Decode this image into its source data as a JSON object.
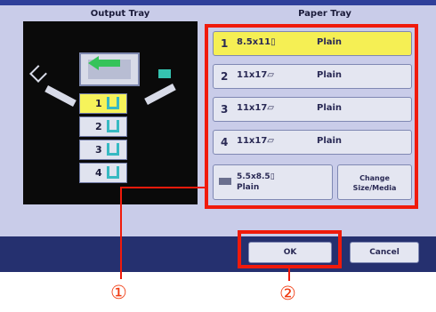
{
  "headers": {
    "output_tray": "Output Tray",
    "paper_tray": "Paper Tray"
  },
  "output_bins": [
    {
      "number": "1",
      "selected": true
    },
    {
      "number": "2",
      "selected": false
    },
    {
      "number": "3",
      "selected": false
    },
    {
      "number": "4",
      "selected": false
    }
  ],
  "paper_trays": [
    {
      "number": "1",
      "size": "8.5x11▯",
      "type": "Plain",
      "selected": true
    },
    {
      "number": "2",
      "size": "11x17▱",
      "type": "Plain",
      "selected": false
    },
    {
      "number": "3",
      "size": "11x17▱",
      "type": "Plain",
      "selected": false
    },
    {
      "number": "4",
      "size": "11x17▱",
      "type": "Plain",
      "selected": false
    }
  ],
  "bypass_tray": {
    "size": "5.5x8.5▯",
    "type": "Plain"
  },
  "change_button": {
    "line1": "Change",
    "line2": "Size/Media"
  },
  "actions": {
    "ok": "OK",
    "cancel": "Cancel"
  },
  "annotations": {
    "marker1": "①",
    "marker2": "②"
  },
  "colors": {
    "highlight": "#f01a0b",
    "selected": "#f5ef54",
    "panel": "#c9cce9"
  }
}
